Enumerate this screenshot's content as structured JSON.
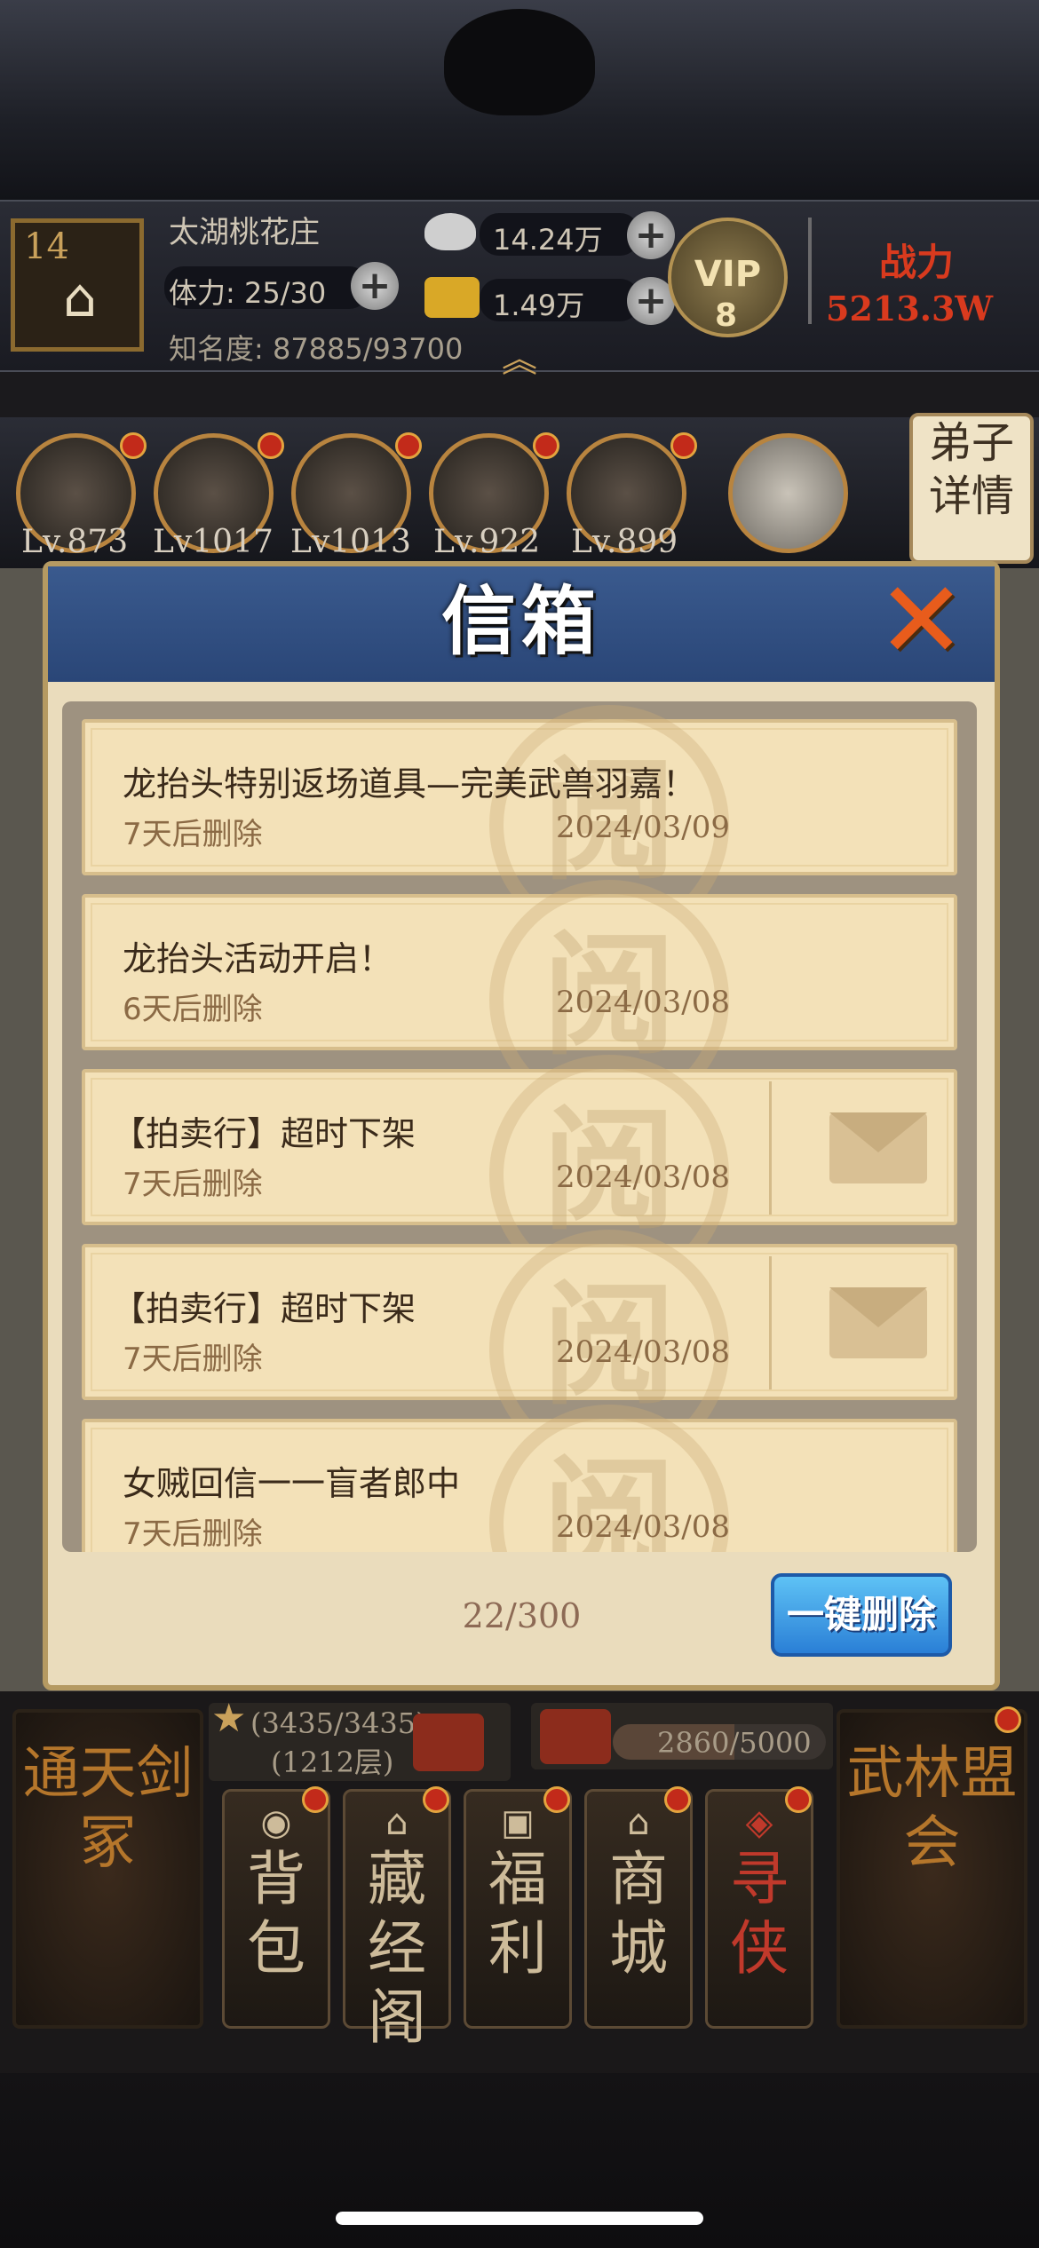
{
  "header": {
    "level": "14",
    "location": "太湖桃花庄",
    "stamina": "体力: 25/30",
    "fame": "知名度: 87885/93700",
    "silver": "14.24万",
    "gold": "1.49万",
    "vip_label": "VIP",
    "vip_level": "8",
    "power_label": "战力",
    "power_value": "5213.3W"
  },
  "disciples": {
    "levels": [
      "Lv.873",
      "Lv1017",
      "Lv1013",
      "Lv.922",
      "Lv.899"
    ],
    "detail_label": "弟子详情"
  },
  "mailbox": {
    "title": "信箱",
    "mails": [
      {
        "title": "龙抬头特别返场道具—完美武兽羽嘉！",
        "expire": "7天后删除",
        "date": "2024/03/09"
      },
      {
        "title": "龙抬头活动开启！",
        "expire": "6天后删除",
        "date": "2024/03/08"
      },
      {
        "title": "【拍卖行】超时下架",
        "expire": "7天后删除",
        "date": "2024/03/08"
      },
      {
        "title": "【拍卖行】超时下架",
        "expire": "7天后删除",
        "date": "2024/03/08"
      },
      {
        "title": "女贼回信一一盲者郎中",
        "expire": "7天后删除",
        "date": "2024/03/08"
      }
    ],
    "stamp_char": "阅",
    "count": "22/300",
    "delete_all_label": "一键删除"
  },
  "bottom": {
    "tower_progress": "(3435/3435)",
    "tower_floor": "(1212层)",
    "chest_progress": "2860/5000",
    "left_side": "通天剑冢",
    "right_side": "武林盟会",
    "menu": [
      "背包",
      "藏经阁",
      "福利",
      "商城",
      "寻侠"
    ]
  }
}
